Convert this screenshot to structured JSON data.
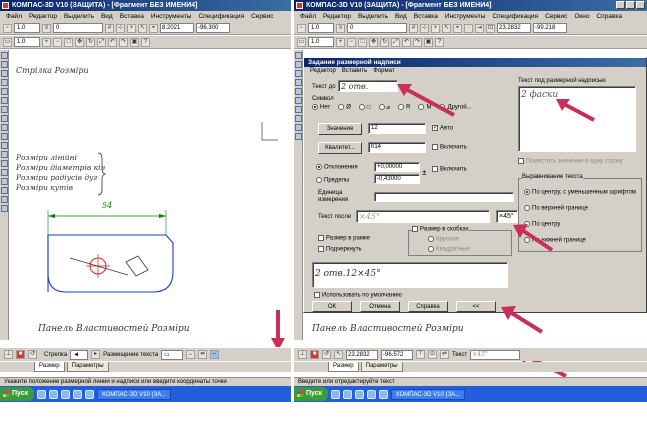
{
  "left": {
    "title": "КОМПАС-3D V10 (ЗАЩИТА) - [Фрагмент БЕЗ ИМЕНИ4]",
    "menu": [
      "Файл",
      "Редактор",
      "Выделить",
      "Вид",
      "Вставка",
      "Инструменты",
      "Спецификация",
      "Сервис"
    ],
    "toolbar1": {
      "scale": "1.0",
      "layer": "0",
      "coord_x": "8.2021",
      "coord_y": "-96.300"
    },
    "toolbar2": {
      "scale": "1.0"
    },
    "notes": {
      "top": "Стрілка Розміри",
      "line1": "Розміри лінійні",
      "line2": "Розміри діаметрів кіл",
      "line3": "Розміри радіусів дуг",
      "line4": "Розміри кутів"
    },
    "dimension_value": "54",
    "panel_caption": "Панель Властивостей Розміри",
    "props": {
      "arrow_label": "Стрелка",
      "placement_label": "Размещение текста"
    },
    "tabs": [
      "Размер",
      "Параметры"
    ],
    "status": "Укажите положение размерной линии и надписи или введите координаты точки",
    "taskbar": {
      "start": "Пуск",
      "item": "КОМПАС-3D V10 (ЗА..."
    }
  },
  "right": {
    "title": "КОМПАС-3D V10 (ЗАЩИТА) - [Фрагмент БЕЗ ИМЕНИ4]",
    "menu": [
      "Файл",
      "Редактор",
      "Выделить",
      "Вид",
      "Вставка",
      "Инструменты",
      "Спецификация",
      "Сервис",
      "Окно",
      "Справка"
    ],
    "toolbar1": {
      "scale": "1.0",
      "layer": "0",
      "coord_x": "23.2832",
      "coord_y": "-99.218"
    },
    "toolbar2": {
      "scale": "1.0"
    },
    "dialog": {
      "title": "Задание размерной надписи",
      "menu": [
        "Редактор",
        "Вставить",
        "Формат"
      ],
      "text_before_label": "Текст до",
      "text_before_value": "2 отв.",
      "symbol_label": "Символ",
      "symbol_options": [
        "Нет",
        "Ø",
        "□",
        "⌀",
        "R",
        "M",
        "Другой..."
      ],
      "value_button": "Значение",
      "value": "12",
      "auto_label": "Авто",
      "quality_button": "Квалитет...",
      "quality_value": "h14",
      "quality_include": "Включить",
      "deviations_label": "Отклонения",
      "limits_label": "Пределы",
      "dev_upper": "+0,00000",
      "dev_lower": "-0,43000",
      "dev_include": "Включить",
      "unit_label": "Единица измерения",
      "text_after_label": "Текст после",
      "text_after_value": "×45°",
      "text_after_symbol": "×45°",
      "in_frame": "Размер в рамке",
      "underline": "Подчеркнуть",
      "in_brackets": "Размер в скобках",
      "round_br": "Круглые",
      "square_br": "Квадратные",
      "preview": "2 отв.12×45°",
      "use_default": "Использовать по умолчанию",
      "buttons": [
        "ОК",
        "Отмена",
        "Справка",
        "<<"
      ],
      "text_under_label": "Текст под размерной надписью",
      "text_under_value": "2 фаски",
      "place_on_shelf": "Поместить значение в одну строку",
      "align_group": "Выравнивание текста",
      "align_options": [
        "По центру, с уменьшенным шрифтом",
        "По верхней границе",
        "По центру",
        "По нижней границе"
      ]
    },
    "panel_caption": "Панель Властивостей Розміри",
    "props": {
      "coord_x": "23.2832",
      "coord_y": "-96.572",
      "text_label": "Текст",
      "text_value": "×45°"
    },
    "tabs": [
      "Размер",
      "Параметры"
    ],
    "status": "Введите или отредактируйте текст",
    "taskbar": {
      "start": "Пуск",
      "item": "КОМПАС-3D V10 (ЗА..."
    }
  },
  "colors": {
    "arrow": "#c83058",
    "titlebar": "#0a246a",
    "taskbar": "#245edb",
    "shape": "#1a3ec8",
    "circle": "#e02020"
  }
}
